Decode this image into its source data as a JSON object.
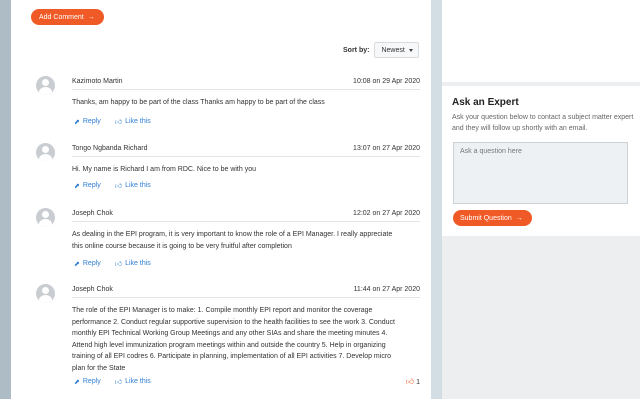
{
  "add_comment": {
    "label": "Add Comment",
    "icon": "arrow-right"
  },
  "sort": {
    "label": "Sort by:",
    "value": "Newest"
  },
  "comments": [
    {
      "author": "Kazimoto Martin",
      "time": "10:08 on 29 Apr 2020",
      "lines": [
        "Thanks, am happy to be part of the class Thanks am happy to be part of the class"
      ],
      "reply": "Reply",
      "like": "Like this"
    },
    {
      "author": "Tongo Ngbanda Richard",
      "time": "13:07 on 27 Apr 2020",
      "lines": [
        "Hi. My name is Richard I am from RDC. Nice to be with you"
      ],
      "reply": "Reply",
      "like": "Like this"
    },
    {
      "author": "Joseph Chok",
      "time": "12:02 on 27 Apr 2020",
      "lines": [
        "As dealing in the EPI program, it is very important to know the role of a EPI Manager. I really appreciate",
        "this online course because it is going to be very fruitful after completion"
      ],
      "reply": "Reply",
      "like": "Like this"
    },
    {
      "author": "Joseph Chok",
      "time": "11:44 on 27 Apr 2020",
      "lines": [
        "The role of the EPI Manager is to make: 1. Compile monthly EPI report and monitor the coverage",
        "performance 2. Conduct regular supportive supervision to the health facilities to see the work 3. Conduct",
        "monthly EPI Technical Working Group Meetings and any other SIAs and share the meeting minutes 4.",
        "Attend high level immunization program meetings within and outside the country 5. Help in organizing",
        "training of all EPI codres 6. Participate in planning, implementation of all EPI activities 7. Develop micro",
        "plan for the State"
      ],
      "reply": "Reply",
      "like": "Like this",
      "like_count": "1"
    }
  ],
  "expert": {
    "title": "Ask an Expert",
    "description": "Ask your question below to contact a subject matter expert and they will follow up shortly with an email.",
    "placeholder": "Ask a question here",
    "submit": "Submit Question"
  },
  "colors": {
    "accent": "#f05a26",
    "link": "#2f7fd1"
  }
}
